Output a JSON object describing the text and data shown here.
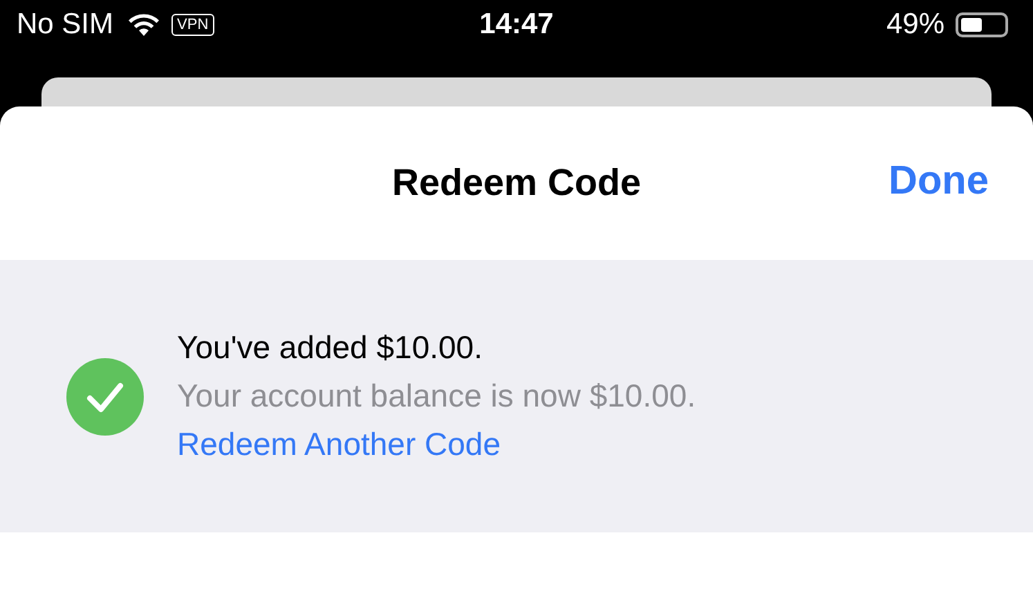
{
  "status_bar": {
    "carrier": "No SIM",
    "vpn": "VPN",
    "time": "14:47",
    "battery_percent": "49%"
  },
  "sheet": {
    "title": "Redeem Code",
    "done": "Done"
  },
  "result": {
    "success": true,
    "headline": "You've added $10.00.",
    "detail": "Your account balance is now $10.00.",
    "link": "Redeem Another Code"
  }
}
